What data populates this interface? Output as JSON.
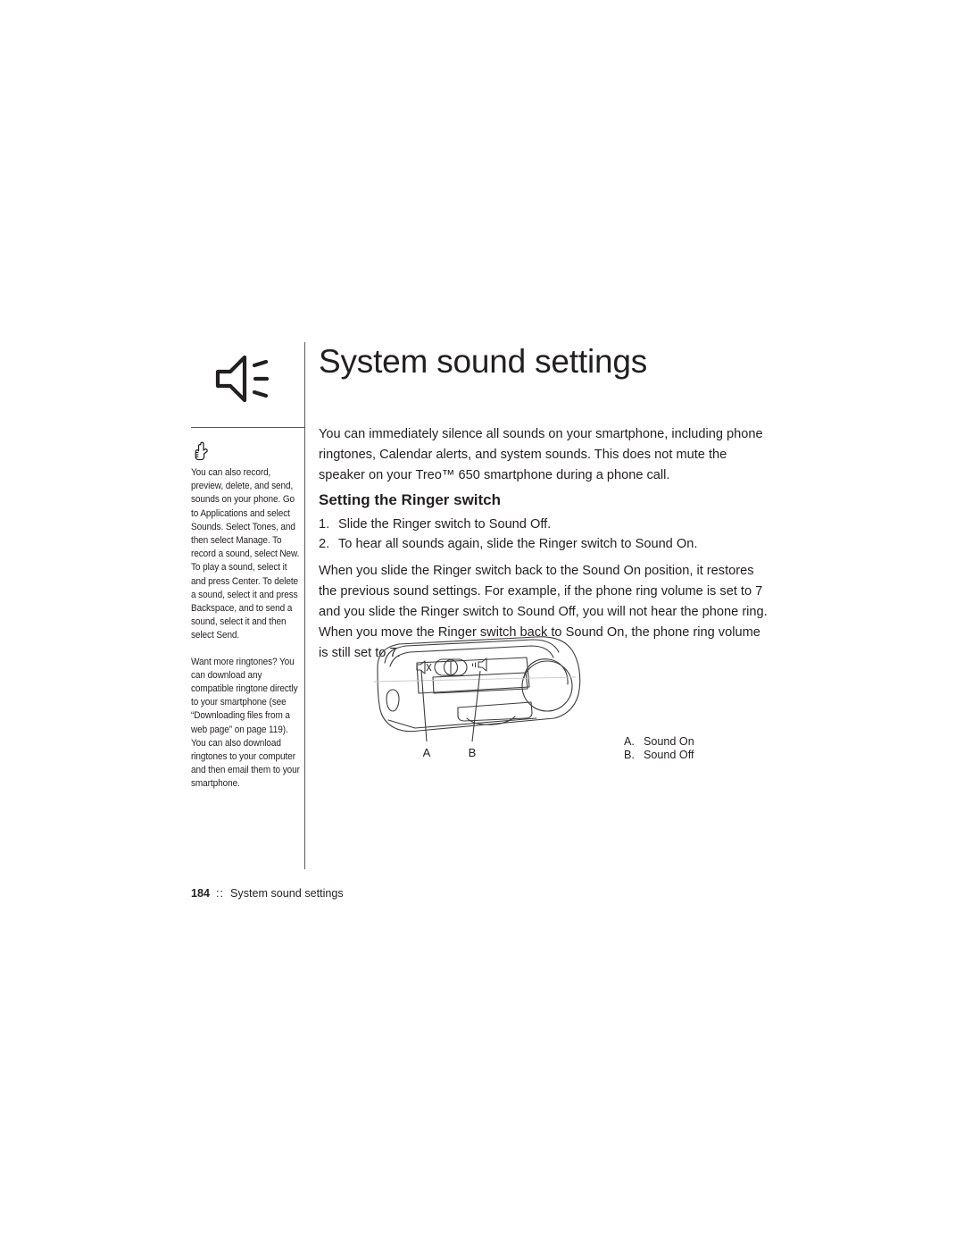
{
  "page": {
    "title": "System sound settings",
    "chapter_icon": "speaker-sound-icon"
  },
  "sidebar": {
    "tip_icon": "pointing-hand-icon",
    "tips": [
      "You can also record, preview, delete, and send, sounds on your phone. Go to Applications and select Sounds. Select Tones, and then select Manage. To record a sound, select New. To play a sound, select it and press Center. To delete a sound, select it and press Backspace, and to send a sound, select it and then select Send.",
      "Want more ringtones? You can download any compatible ringtone directly to your smartphone (see “Downloading files from a web page” on page 119). You can also download ringtones to your computer and then email them to your smartphone."
    ]
  },
  "main": {
    "intro": "You can immediately silence all sounds on your smartphone, including phone ringtones, Calendar alerts, and system sounds. This does not mute the speaker on your Treo™ 650 smartphone during a phone call.",
    "section_heading": "Setting the Ringer switch",
    "steps": [
      {
        "num": "1.",
        "text": "Slide the Ringer switch to Sound Off."
      },
      {
        "num": "2.",
        "text": "To hear all sounds again, slide the Ringer switch to Sound On."
      }
    ],
    "explanation": "When you slide the Ringer switch back to the Sound On position, it restores the previous sound settings. For example, if the phone ring volume is set to 7 and you slide the Ringer switch to Sound Off, you will not hear the phone ring. When you move the Ringer switch back to Sound On, the phone ring volume is still set to 7."
  },
  "figure": {
    "caption_alt": "Top view of Treo smartphone showing the Ringer switch",
    "callout_a": "A",
    "callout_b": "B",
    "legend": [
      {
        "key": "A.",
        "label": "Sound On"
      },
      {
        "key": "B.",
        "label": "Sound Off"
      }
    ]
  },
  "footer": {
    "page_number": "184",
    "separator": "::",
    "section": "System sound settings"
  },
  "colors": {
    "ink": "#231f20",
    "rule": "#58595b",
    "line_art": "#3c3c3c",
    "background": "#ffffff"
  }
}
